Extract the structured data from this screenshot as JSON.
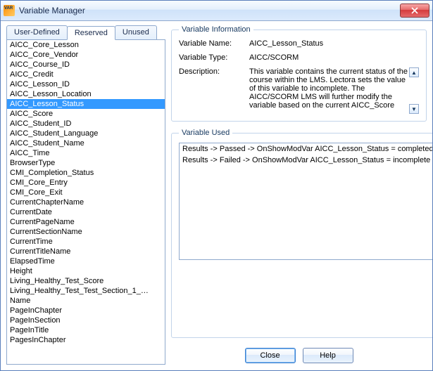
{
  "window": {
    "title": "Variable Manager"
  },
  "tabs": {
    "user_defined": "User-Defined",
    "reserved": "Reserved",
    "unused": "Unused",
    "active": "reserved"
  },
  "variables": [
    "AICC_Core_Lesson",
    "AICC_Core_Vendor",
    "AICC_Course_ID",
    "AICC_Credit",
    "AICC_Lesson_ID",
    "AICC_Lesson_Location",
    "AICC_Lesson_Status",
    "AICC_Score",
    "AICC_Student_ID",
    "AICC_Student_Language",
    "AICC_Student_Name",
    "AICC_Time",
    "BrowserType",
    "CMI_Completion_Status",
    "CMI_Core_Entry",
    "CMI_Core_Exit",
    "CurrentChapterName",
    "CurrentDate",
    "CurrentPageName",
    "CurrentSectionName",
    "CurrentTime",
    "CurrentTitleName",
    "ElapsedTime",
    "Height",
    "Living_Healthy_Test_Score",
    "Living_Healthy_Test_Test_Section_1_…",
    "Name",
    "PageInChapter",
    "PageInSection",
    "PageInTitle",
    "PagesInChapter"
  ],
  "selected_variable": "AICC_Lesson_Status",
  "info": {
    "legend": "Variable Information",
    "name_label": "Variable Name:",
    "name_value": "AICC_Lesson_Status",
    "type_label": "Variable Type:",
    "type_value": "AICC/SCORM",
    "desc_label": "Description:",
    "desc_value": "This variable contains the current status of the course within the LMS. Lectora sets the value of this variable to incomplete. The AICC/SCORM LMS will further modify the variable based on the current AICC_Score"
  },
  "used": {
    "legend": "Variable Used",
    "rows": [
      "Results -> Passed -> OnShowModVar AICC_Lesson_Status = completed",
      "Results -> Failed -> OnShowModVar AICC_Lesson_Status = incomplete"
    ]
  },
  "buttons": {
    "close": "Close",
    "help": "Help"
  }
}
